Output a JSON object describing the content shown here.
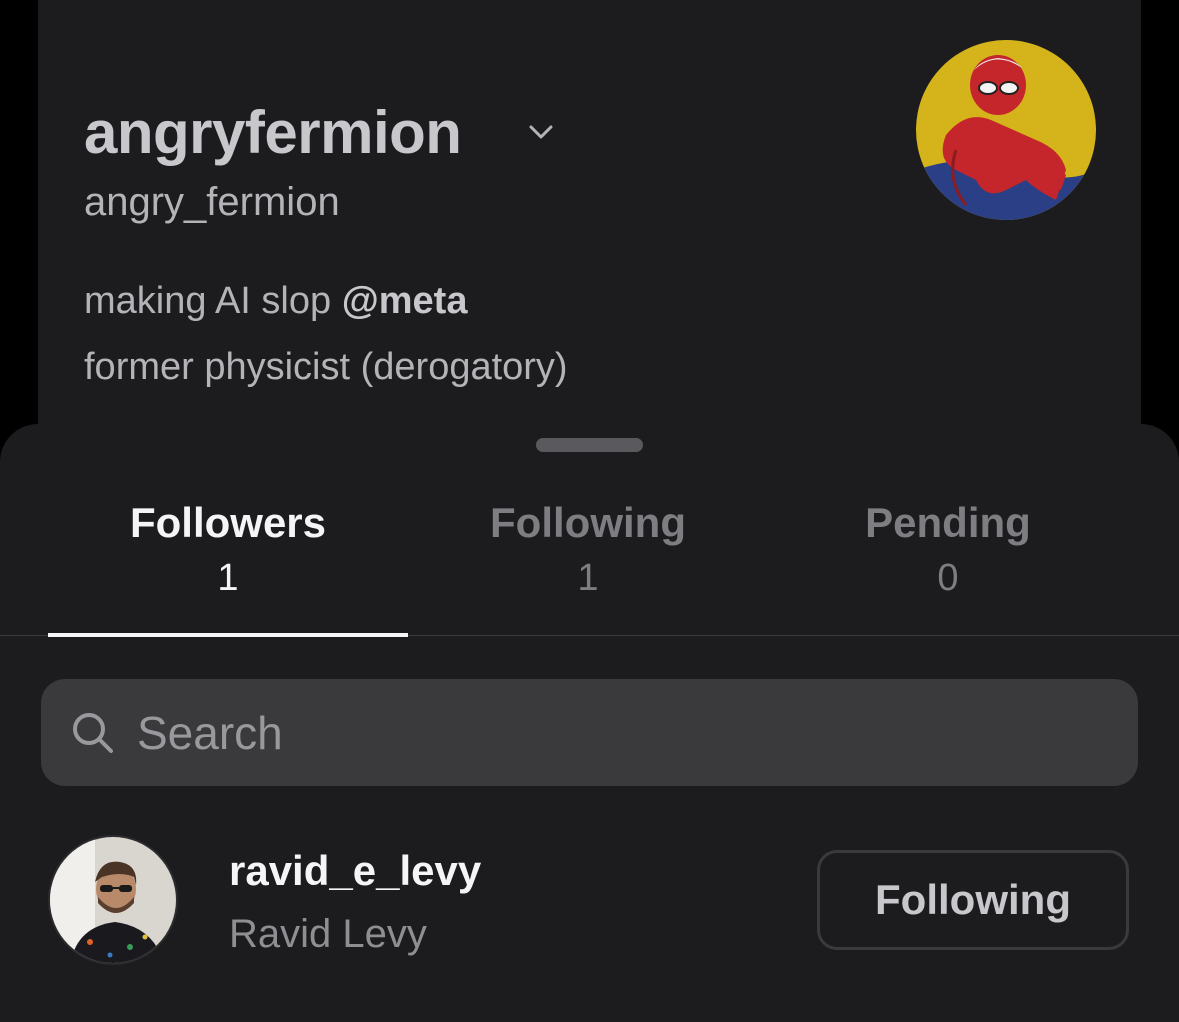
{
  "profile": {
    "display_name": "angryfermion",
    "handle": "angry_fermion",
    "bio_line1_text": "making AI slop ",
    "bio_line1_mention": "@meta",
    "bio_line2": "former physicist (derogatory)",
    "avatar_icon": "spiderman-avatar",
    "dropdown_icon": "chevron-down-icon"
  },
  "tabs": [
    {
      "label": "Followers",
      "count": "1",
      "active": true
    },
    {
      "label": "Following",
      "count": "1",
      "active": false
    },
    {
      "label": "Pending",
      "count": "0",
      "active": false
    }
  ],
  "search": {
    "placeholder": "Search",
    "value": ""
  },
  "users": [
    {
      "username": "ravid_e_levy",
      "full_name": "Ravid Levy",
      "button_label": "Following"
    }
  ],
  "colors": {
    "background": "#000000",
    "surface": "#1c1c1e",
    "search_bg": "#3a3a3c",
    "text_primary": "#f5f5f7",
    "text_secondary": "#8e8e93"
  }
}
